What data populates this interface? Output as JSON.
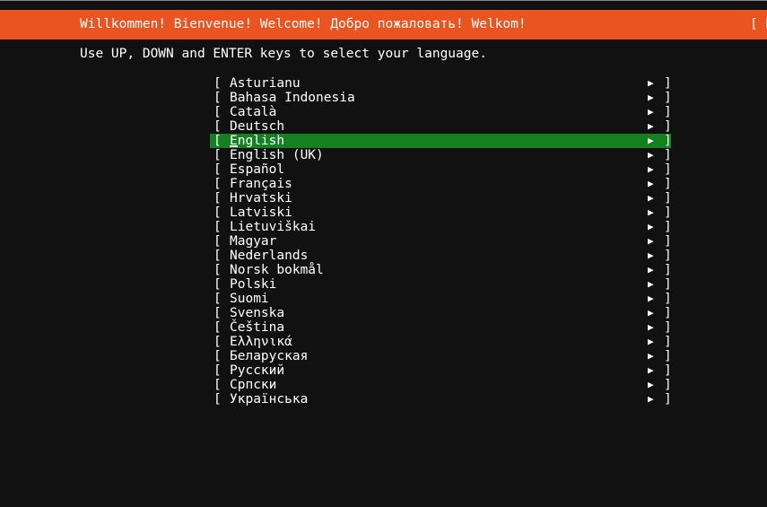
{
  "banner": {
    "title": "Willkommen! Bienvenue! Welcome! Добро пожаловать! Welkom!",
    "help_label": "[ H",
    "background_color": "#e95420",
    "text_color": "#ffffff"
  },
  "instructions": {
    "text": "Use UP, DOWN and ENTER keys to select your language."
  },
  "screen": {
    "background_color": "#111111",
    "selection_color": "#158020"
  },
  "icons": {
    "arrow": "▶",
    "bracket_open": "[",
    "bracket_close": "]"
  },
  "language_list": {
    "selected_index": 4,
    "items": [
      {
        "label": "Asturianu"
      },
      {
        "label": "Bahasa Indonesia"
      },
      {
        "label": "Català"
      },
      {
        "label": "Deutsch"
      },
      {
        "label": "English"
      },
      {
        "label": "English (UK)"
      },
      {
        "label": "Español"
      },
      {
        "label": "Français"
      },
      {
        "label": "Hrvatski"
      },
      {
        "label": "Latviski"
      },
      {
        "label": "Lietuviškai"
      },
      {
        "label": "Magyar"
      },
      {
        "label": "Nederlands"
      },
      {
        "label": "Norsk bokmål"
      },
      {
        "label": "Polski"
      },
      {
        "label": "Suomi"
      },
      {
        "label": "Svenska"
      },
      {
        "label": "Čeština"
      },
      {
        "label": "Ελληνικά"
      },
      {
        "label": "Беларуская"
      },
      {
        "label": "Русский"
      },
      {
        "label": "Српски"
      },
      {
        "label": "Українська"
      }
    ]
  }
}
